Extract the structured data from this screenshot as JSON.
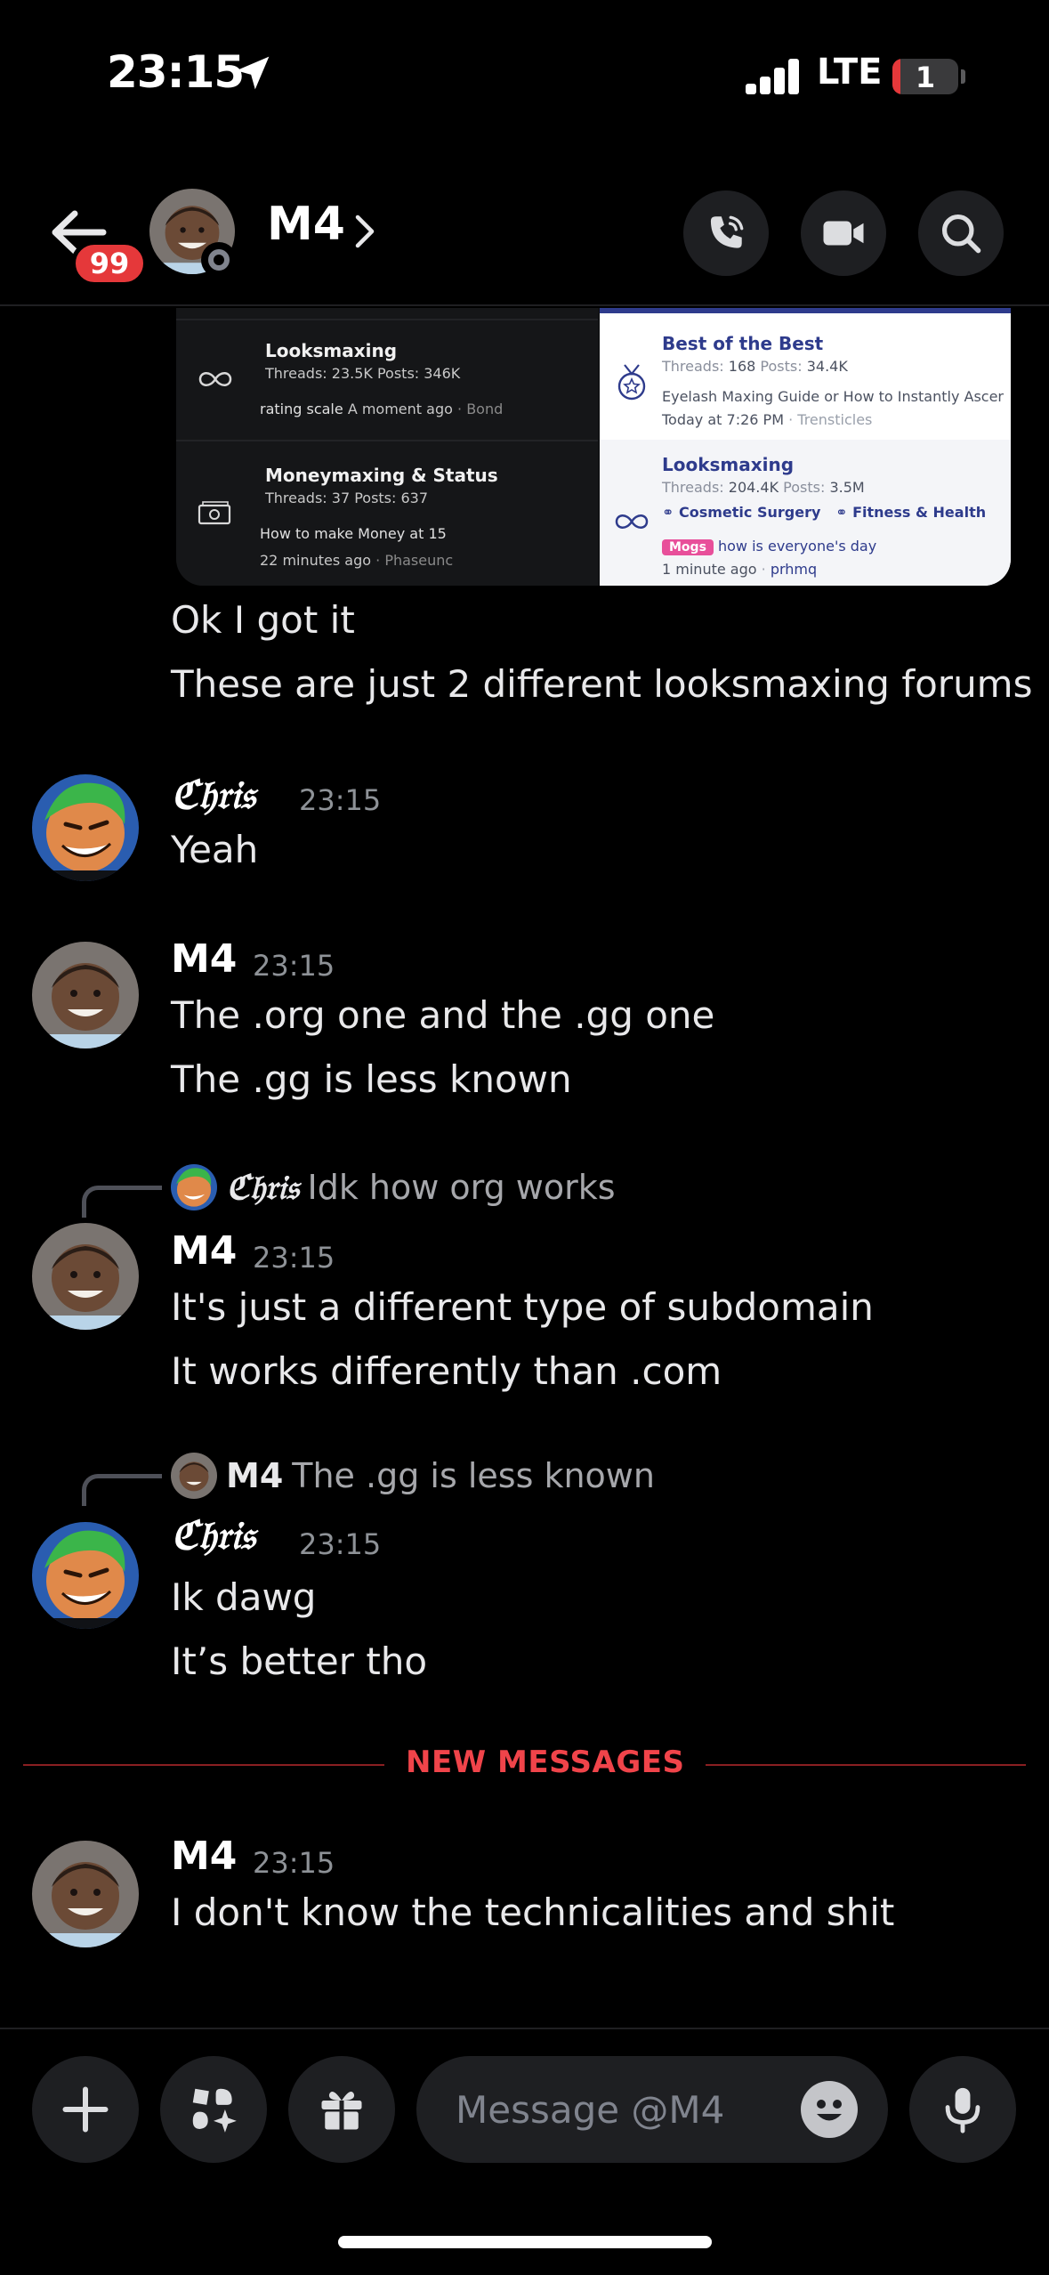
{
  "status_bar": {
    "time": "23:15",
    "network": "LTE",
    "battery": "1",
    "battery_level_pct": 12
  },
  "header": {
    "unread_count": "99",
    "name": "M4",
    "icons": [
      "back-arrow-icon",
      "phone-icon",
      "video-camera-icon",
      "search-icon"
    ]
  },
  "embed": {
    "left": {
      "f1_title": "Looksmaxing",
      "f1_stats": "Threads: 23.5K Posts: 346K",
      "f1_thread": "rating scale",
      "f1_meta": "A moment ago",
      "f1_author": "Bond",
      "f2_title": "Moneymaxing & Status",
      "f2_stats": "Threads: 37 Posts: 637",
      "f2_thread": "How to make Money at 15",
      "f2_meta": "22 minutes ago",
      "f2_author": "Phaseunc"
    },
    "right": {
      "f1_title": "Best of the Best",
      "f1_threads_label": "Threads:",
      "f1_threads": "168",
      "f1_posts_label": "Posts:",
      "f1_posts": "34.4K",
      "f1_thread": "Eyelash Maxing Guide or How to Instantly Ascen...",
      "f1_meta": "Today at 7:26 PM",
      "f1_author": "Trensticles",
      "f2_title": "Looksmaxing",
      "f2_threads_label": "Threads:",
      "f2_threads": "204.4K",
      "f2_posts_label": "Posts:",
      "f2_posts": "3.5M",
      "f2_sub1": "Cosmetic Surgery",
      "f2_sub2": "Fitness & Health",
      "f2_tag": "Mogs",
      "f2_thread": "how is everyone's day",
      "f2_meta": "1 minute ago",
      "f2_author": "prhmq"
    }
  },
  "messages": [
    {
      "lines": [
        "Ok I got it",
        "These are just 2 different looksmaxing forums"
      ]
    },
    {
      "author": "ℭ𝔥𝔯𝔦𝔰",
      "time": "23:15",
      "lines": [
        "Yeah"
      ]
    },
    {
      "author": "M4",
      "time": "23:15",
      "lines": [
        "The .org one and the .gg one",
        "The .gg is less known"
      ]
    },
    {
      "reply_author": "ℭ𝔥𝔯𝔦𝔰",
      "reply_text": "Idk how org works",
      "author": "M4",
      "time": "23:15",
      "lines": [
        "It's just a different type of subdomain",
        "It works differently than .com"
      ]
    },
    {
      "reply_author": "M4",
      "reply_text": "The .gg is less known",
      "author": "ℭ𝔥𝔯𝔦𝔰",
      "time": "23:15",
      "lines": [
        "Ik dawg",
        "It’s better tho"
      ]
    },
    {
      "author": "M4",
      "time": "23:15",
      "lines": [
        "I don't know the technicalities and shit"
      ]
    }
  ],
  "divider": {
    "label": "NEW MESSAGES"
  },
  "composer": {
    "placeholder": "Message @M4",
    "icons": [
      "plus-icon",
      "apps-icon",
      "gift-icon",
      "emoji-icon",
      "microphone-icon"
    ]
  },
  "colors": {
    "background": "#000000",
    "accent_red": "#f0444a",
    "badge_red": "#e5383a",
    "forum_blue": "#2e3b8c"
  }
}
